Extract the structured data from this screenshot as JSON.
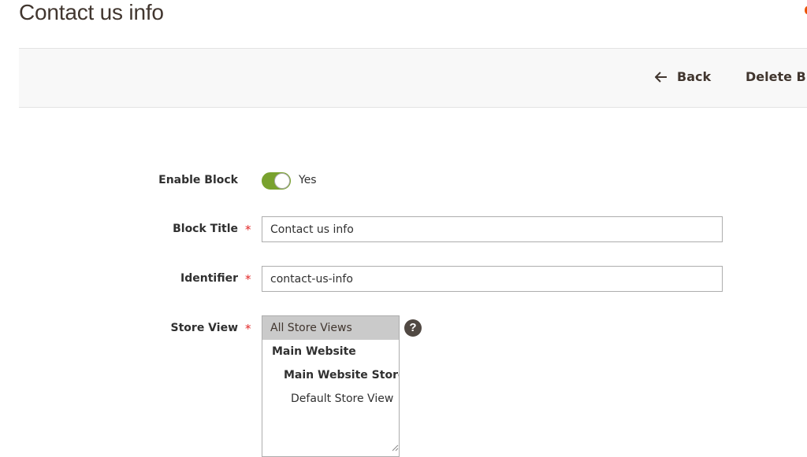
{
  "page": {
    "title": "Contact us info"
  },
  "toolbar": {
    "back_label": "Back",
    "delete_label": "Delete Block"
  },
  "form": {
    "enable": {
      "label": "Enable Block",
      "value": "Yes",
      "on": true
    },
    "title": {
      "label": "Block Title",
      "required_mark": "*",
      "value": "Contact us info"
    },
    "identifier": {
      "label": "Identifier",
      "required_mark": "*",
      "value": "contact-us-info"
    },
    "store_view": {
      "label": "Store View",
      "required_mark": "*",
      "help_icon": "?",
      "options": [
        "All Store Views",
        "Main Website",
        "Main Website Store",
        "Default Store View"
      ],
      "selected": "All Store Views"
    }
  },
  "colors": {
    "accent": "#eb5202",
    "toggle_on": "#79a22e",
    "required": "#e22626"
  },
  "icons": {
    "back": "arrow-left-icon",
    "help": "question-circle-icon"
  }
}
